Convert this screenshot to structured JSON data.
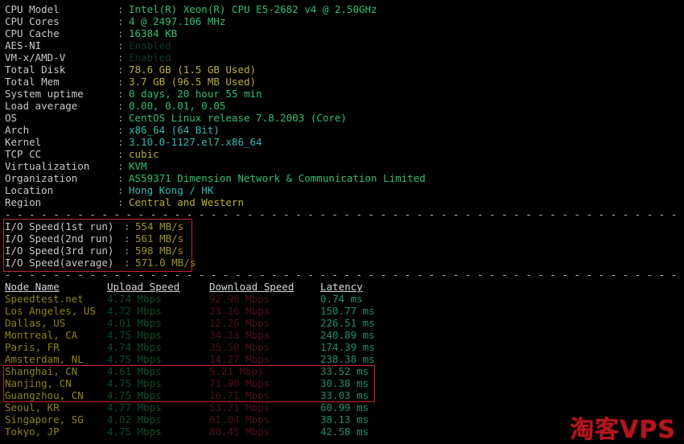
{
  "terminal": {
    "colon": ":",
    "separator_char": "-"
  },
  "system_info": [
    {
      "label": "CPU Model",
      "value": "Intel(R) Xeon(R) CPU E5-2682 v4 @ 2.50GHz",
      "tone": "c-green"
    },
    {
      "label": "CPU Cores",
      "value": "4 @ 2497.106 MHz",
      "tone": "c-green"
    },
    {
      "label": "CPU Cache",
      "value": "16384 KB",
      "tone": "c-green"
    },
    {
      "label": "AES-NI",
      "value": "Enabled",
      "tone": "c-green-dim"
    },
    {
      "label": "VM-x/AMD-V",
      "value": "Enabled",
      "tone": "c-green-dim"
    },
    {
      "label": "Total Disk",
      "value": "78.6 GB (1.5 GB Used)",
      "tone": "c-yellow"
    },
    {
      "label": "Total Mem",
      "value": "3.7 GB (96.5 MB Used)",
      "tone": "c-yellow"
    },
    {
      "label": "System uptime",
      "value": "0 days, 20 hour 55 min",
      "tone": "c-green"
    },
    {
      "label": "Load average",
      "value": "0.00, 0.01, 0.05",
      "tone": "c-green"
    },
    {
      "label": "OS",
      "value": "CentOS Linux release 7.8.2003 (Core)",
      "tone": "c-green"
    },
    {
      "label": "Arch",
      "value": "x86_64 (64 Bit)",
      "tone": "c-cyan"
    },
    {
      "label": "Kernel",
      "value": "3.10.0-1127.el7.x86_64",
      "tone": "c-cyan"
    },
    {
      "label": "TCP CC",
      "value": "cubic",
      "tone": "c-yellow"
    },
    {
      "label": "Virtualization",
      "value": "KVM",
      "tone": "c-green"
    },
    {
      "label": "Organization",
      "value": "AS59371 Dimension Network & Communication Limited",
      "tone": "c-green"
    },
    {
      "label": "Location",
      "value": "Hong Kong / HK",
      "tone": "c-cyan"
    },
    {
      "label": "Region",
      "value": "Central and Western",
      "tone": "c-yellow"
    }
  ],
  "io_speed": {
    "rows": [
      {
        "label": "I/O Speed(1st run)",
        "value": "554 MB/s"
      },
      {
        "label": "I/O Speed(2nd run)",
        "value": "561 MB/s"
      },
      {
        "label": "I/O Speed(3rd run)",
        "value": "598 MB/s"
      },
      {
        "label": "I/O Speed(average)",
        "value": "571.0 MB/s"
      }
    ]
  },
  "node_table": {
    "headers": {
      "node": "Node Name",
      "upload": "Upload Speed",
      "download": "Download Speed",
      "latency": "Latency"
    },
    "rows": [
      {
        "node": "Speedtest.net",
        "upload": "4.74 Mbps",
        "download": "92.96 Mbps",
        "latency": "0.74 ms"
      },
      {
        "node": "Los Angeles, US",
        "upload": "4.72 Mbps",
        "download": "23.16 Mbps",
        "latency": "150.77 ms"
      },
      {
        "node": "Dallas, US",
        "upload": "4.01 Mbps",
        "download": "12.26 Mbps",
        "latency": "226.51 ms"
      },
      {
        "node": "Montreal, CA",
        "upload": "4.75 Mbps",
        "download": "34.13 Mbps",
        "latency": "240.89 ms"
      },
      {
        "node": "Paris, FR",
        "upload": "4.74 Mbps",
        "download": "35.50 Mbps",
        "latency": "174.39 ms"
      },
      {
        "node": "Amsterdam, NL",
        "upload": "4.75 Mbps",
        "download": "14.27 Mbps",
        "latency": "238.38 ms"
      },
      {
        "node": "Shanghai, CN",
        "upload": "4.61 Mbps",
        "download": "5.21 Mbps",
        "latency": "33.52 ms"
      },
      {
        "node": "Nanjing, CN",
        "upload": "4.75 Mbps",
        "download": "71.90 Mbps",
        "latency": "30.38 ms"
      },
      {
        "node": "Guangzhou, CN",
        "upload": "4.75 Mbps",
        "download": "16.71 Mbps",
        "latency": "33.03 ms"
      },
      {
        "node": "Seoul, KR",
        "upload": "4.77 Mbps",
        "download": "53.71 Mbps",
        "latency": "60.99 ms"
      },
      {
        "node": "Singapore, SG",
        "upload": "4.02 Mbps",
        "download": "61.04 Mbps",
        "latency": "38.13 ms"
      },
      {
        "node": "Tokyo, JP",
        "upload": "4.75 Mbps",
        "download": "80.45 Mbps",
        "latency": "42.58 ms"
      }
    ]
  },
  "annotations": {
    "io_highlight_label": "io-speed-highlight",
    "node_highlight_label": "china-nodes-highlight",
    "box_color": "#c0272d"
  },
  "watermark": {
    "text": "淘客VPS",
    "color": "#b3161c"
  }
}
